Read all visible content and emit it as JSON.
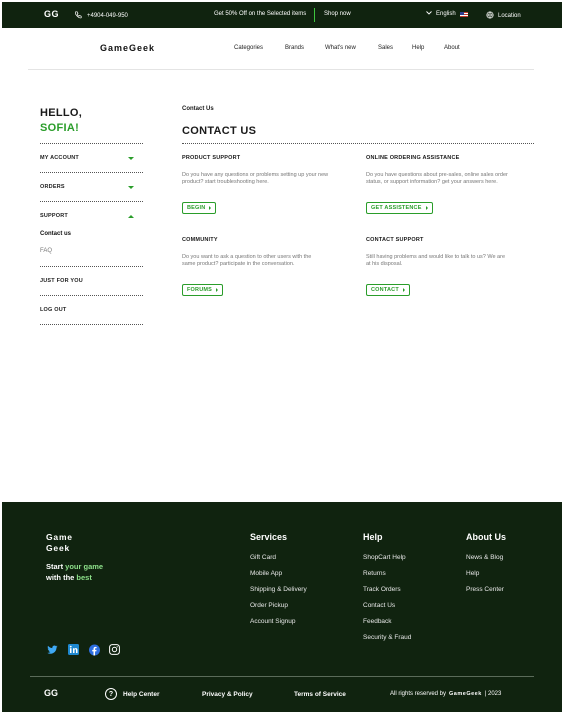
{
  "topbar": {
    "logo": "GG",
    "phone": "+4904-049-950",
    "promo": "Get 50% Off on the Selected items",
    "shop_now": "Shop now",
    "language": "English",
    "location": "Location"
  },
  "header": {
    "brand": "GameGeek",
    "nav": [
      "Categories",
      "Brands",
      "What's new",
      "Sales",
      "Help",
      "About"
    ]
  },
  "sidebar": {
    "greeting": "HELLO,",
    "user_name": "SOFIA!",
    "items": [
      {
        "label": "MY ACCOUNT",
        "caret": "down"
      },
      {
        "label": "ORDERS",
        "caret": "down"
      },
      {
        "label": "SUPPORT",
        "caret": "up"
      },
      {
        "label": "JUST FOR YOU"
      },
      {
        "label": "LOG OUT"
      }
    ],
    "support_sub": [
      "Contact us",
      "FAQ"
    ]
  },
  "main": {
    "breadcrumb": "Contact Us",
    "title": "CONTACT US",
    "cards": [
      {
        "title": "PRODUCT SUPPORT",
        "desc": "Do you have any questions or problems setting up your new product? start troubleshooting here.",
        "button": "BEGIN"
      },
      {
        "title": "ONLINE ORDERING ASSISTANCE",
        "desc": "Do you have questions about pre-sales, online sales order status, or support information? get your answers here.",
        "button": "GET ASSISTENCE"
      },
      {
        "title": "COMMUNITY",
        "desc": "Do you want to ask a question to other users with the same product? participate in the conversation.",
        "button": "FORUMS"
      },
      {
        "title": "CONTACT SUPPORT",
        "desc": "Still having problems and would like to talk to us? We are at his disposal.",
        "button": "CONTACT"
      }
    ]
  },
  "footer": {
    "logo_line1": "Game",
    "logo_line2": "Geek",
    "tagline_a": "Start ",
    "tagline_b": "your game",
    "tagline_c": "with the ",
    "tagline_d": "best",
    "columns": [
      {
        "title": "Services",
        "links": [
          "Gift Card",
          "Mobile App",
          "Shipping & Delivery",
          "Order Pickup",
          "Account Signup"
        ]
      },
      {
        "title": "Help",
        "links": [
          "ShopCart Help",
          "Returns",
          "Track Orders",
          "Contact Us",
          "Feedback",
          "Security & Fraud"
        ]
      },
      {
        "title": "About Us",
        "links": [
          "News & Blog",
          "Help",
          "Press Center"
        ]
      }
    ],
    "social": [
      "twitter-icon",
      "linkedin-icon",
      "facebook-icon",
      "instagram-icon"
    ],
    "bottom_logo": "GG",
    "help_center": "Help Center",
    "privacy": "Privacy & Policy",
    "terms": "Terms of Service",
    "copyright": "All rights reserved by",
    "copyright_brand": "GameGeek",
    "year": "| 2023"
  },
  "colors": {
    "dark_green": "#10230f",
    "accent_green": "#2a9d2a",
    "light_green": "#8de08a"
  }
}
